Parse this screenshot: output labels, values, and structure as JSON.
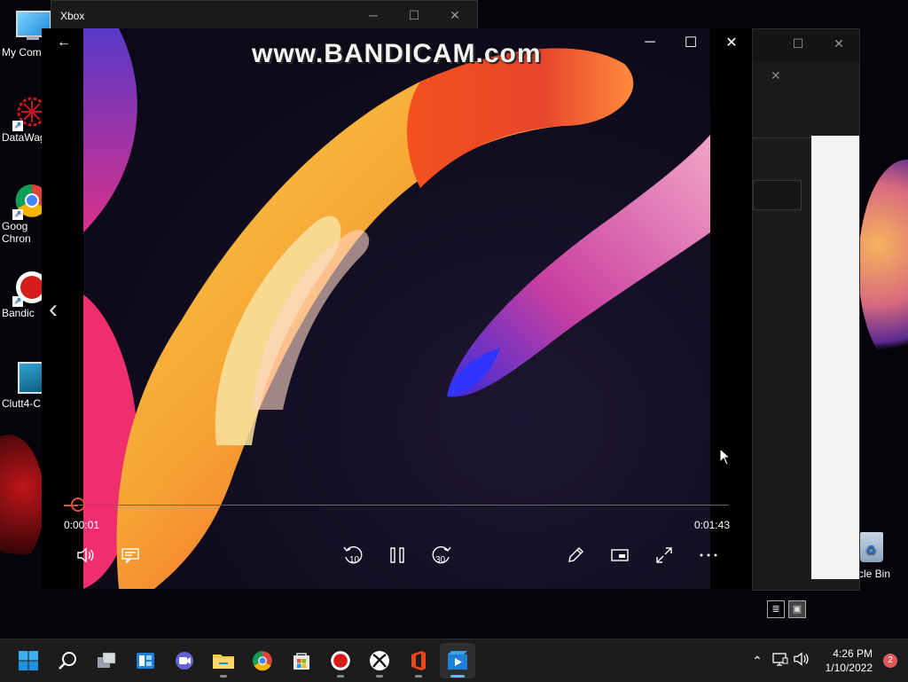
{
  "desktop": {
    "icons": [
      {
        "id": "my-computer",
        "label": "My Com"
      },
      {
        "id": "datawag",
        "label": "DataWag"
      },
      {
        "id": "google-chrome",
        "label": "Goog\nChron"
      },
      {
        "id": "bandicam",
        "label": "Bandic"
      },
      {
        "id": "clutt4",
        "label": "Clutt4-C"
      },
      {
        "id": "recycle-bin",
        "label": "ycle Bin"
      }
    ]
  },
  "bg_window_xbox": {
    "title": "Xbox"
  },
  "player": {
    "watermark": "www.BANDICAM.com",
    "progress": 0.01,
    "time_current": "0:00:01",
    "time_total": "0:01:43",
    "skip_back": "10",
    "skip_forward": "30"
  },
  "taskbar": {
    "time": "4:26 PM",
    "date": "1/10/2022",
    "notification_count": "2"
  },
  "colors": {
    "seek_accent": "#e84a3c",
    "taskbar_active": "#4cc2ff"
  }
}
